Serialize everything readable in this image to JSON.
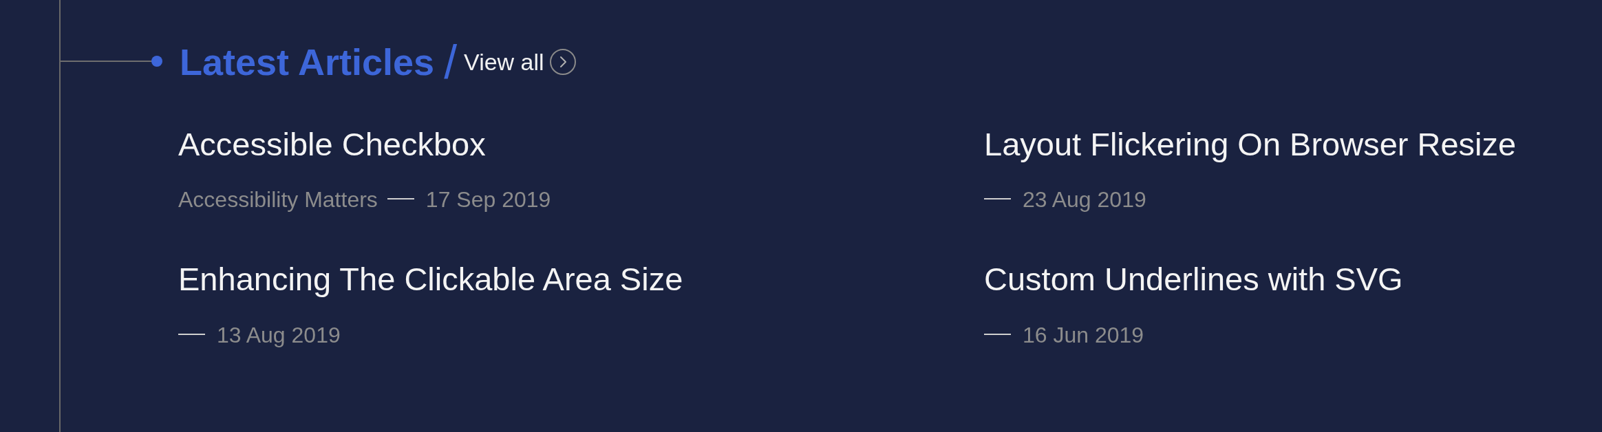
{
  "section": {
    "title": "Latest Articles",
    "separator": "/",
    "link": "View all"
  },
  "articles": [
    {
      "title": "Accessible Checkbox",
      "category": "Accessibility Matters",
      "date": "17 Sep 2019"
    },
    {
      "title": "Layout Flickering On Browser Resize",
      "date": "23 Aug 2019"
    },
    {
      "title": "Enhancing The Clickable Area Size",
      "date": "13 Aug 2019"
    },
    {
      "title": "Custom Underlines with SVG",
      "date": "16 Jun 2019"
    }
  ]
}
